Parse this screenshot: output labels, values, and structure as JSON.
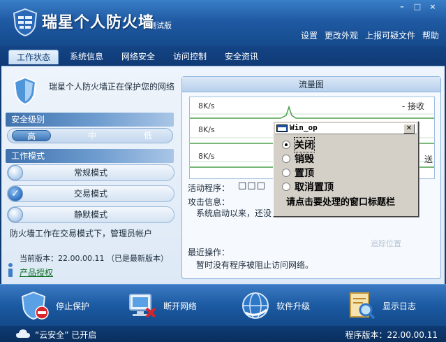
{
  "window": {
    "title": "瑞星个人防火墙",
    "subtitle": "测试版",
    "controls": {
      "minimize": "–",
      "maximize": "□",
      "close": "×"
    },
    "links": [
      "设置",
      "更改外观",
      "上报可疑文件",
      "帮助"
    ]
  },
  "tabs": [
    "工作状态",
    "系统信息",
    "网络安全",
    "访问控制",
    "安全资讯"
  ],
  "left": {
    "protect_text": "瑞星个人防火墙正在保护您的网络",
    "security_header": "安全级别",
    "levels": [
      "高",
      "中",
      "低"
    ],
    "mode_header": "工作模式",
    "modes": [
      "常规模式",
      "交易模式",
      "静默模式"
    ],
    "mode_status": "防火墙工作在交易模式下，管理员帐户",
    "version_line": "当前版本：22.00.00.11 （已是最新版本）",
    "license_link": "产品授权"
  },
  "right": {
    "traffic_header": "流量图",
    "graph_labels": [
      "8K/s",
      "8K/s",
      "8K/s"
    ],
    "recv_label": "- 接收",
    "send_label": "送",
    "activity_label": "活动程序：",
    "activity_boxes": "□□□",
    "attack_label": "攻击信息：",
    "attack_info": "系统启动以来，还没",
    "recent_label": "最近操作：",
    "recent_info": "暂时没有程序被阻止访问网络。",
    "track_pos": "追踪位置"
  },
  "popup": {
    "title": "Win_op",
    "close": "✕",
    "options": [
      "关闭",
      "销毁",
      "置顶",
      "取消置顶"
    ],
    "hint": "请点击要处理的窗口标题栏"
  },
  "toolbar": [
    "停止保护",
    "断开网络",
    "软件升级",
    "显示日志"
  ],
  "status": {
    "cloud_text": "“云安全” 已开启",
    "program_version": "程序版本：22.00.00.11"
  }
}
